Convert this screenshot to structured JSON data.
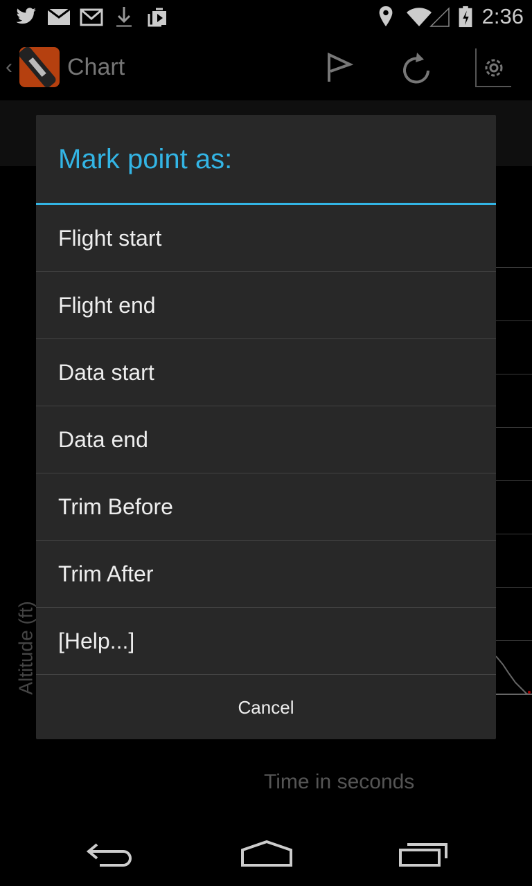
{
  "status_bar": {
    "left_icons": [
      "twitter-icon",
      "gmail-icon",
      "email-icon",
      "download-icon",
      "play-store-icon"
    ],
    "right_icons": [
      "location-icon",
      "wifi-icon",
      "signal-icon",
      "battery-charging-icon"
    ],
    "time": "2:36"
  },
  "action_bar": {
    "title": "Chart",
    "actions": [
      "flag-icon",
      "refresh-icon",
      "settings-icon"
    ]
  },
  "chart_background": {
    "y_axis_label": "Altitude (ft)",
    "x_axis_label": "Time in seconds"
  },
  "dialog": {
    "title": "Mark point as:",
    "accent_color": "#33b5e5",
    "items": [
      {
        "label": "Flight start"
      },
      {
        "label": "Flight end"
      },
      {
        "label": "Data start"
      },
      {
        "label": "Data end"
      },
      {
        "label": "Trim Before"
      },
      {
        "label": "Trim After"
      },
      {
        "label": "[Help...]"
      }
    ],
    "cancel_label": "Cancel"
  },
  "nav_bar": {
    "buttons": [
      "back-icon",
      "home-icon",
      "recent-apps-icon"
    ]
  }
}
